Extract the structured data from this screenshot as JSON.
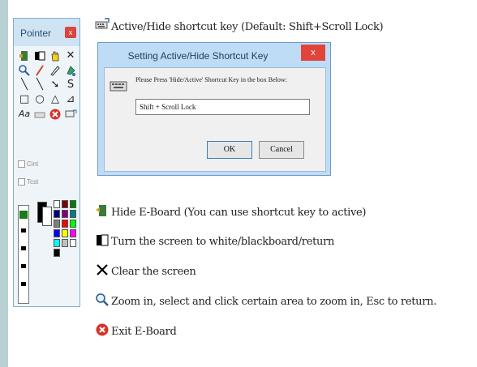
{
  "header_line": {
    "text": "Active/Hide shortcut key (Default: Shift+Scroll Lock)",
    "icon": "shortcut-key-icon"
  },
  "toolbox": {
    "title": "Pointer",
    "close_label": "x",
    "tools": [
      "exit-door-icon",
      "screen-icon",
      "hand-icon",
      "clear-x-icon",
      "zoom-icon",
      "pen-icon",
      "highlighter-icon",
      "color-fill-icon",
      "line-icon",
      "arrow-icon",
      "pointer-icon",
      "curve-icon",
      "rect-icon",
      "ellipse-icon",
      "shape-icon",
      "angle-icon",
      "text-icon",
      "eraser-icon",
      "exit-icon",
      "settings-icon"
    ],
    "check1_label": "Cint",
    "check2_label": "Tcst"
  },
  "dialog": {
    "title": "Setting Active/Hide Shortcut Key",
    "close_label": "x",
    "prompt": "Please Press 'Hide/Active' Shortcut Key in the box Below:",
    "input_value": "Shift + Scroll Lock",
    "ok_label": "OK",
    "cancel_label": "Cancel"
  },
  "lines": [
    {
      "text": "Hide E-Board (You can use shortcut key to active)",
      "icon": "exit-door-icon"
    },
    {
      "text": "Turn the screen to white/blackboard/return",
      "icon": "screen-icon"
    },
    {
      "text": "Clear the screen",
      "icon": "clear-x-icon"
    },
    {
      "text": "Zoom in, select and click certain area to zoom in, Esc to return.",
      "icon": "zoom-icon"
    },
    {
      "text": "Exit E-Board",
      "icon": "exit-icon"
    }
  ],
  "palette_colors": [
    "#ffffff",
    "#7f0000",
    "#007f00",
    "#00007f",
    "#7f007f",
    "#007f7f",
    "#7f7f7f",
    "#ff0000",
    "#00ff00",
    "#0000ff",
    "#ffff00",
    "#ff00ff",
    "#00ffff",
    "#c0c0c0",
    "#ffffff",
    "#000000"
  ]
}
